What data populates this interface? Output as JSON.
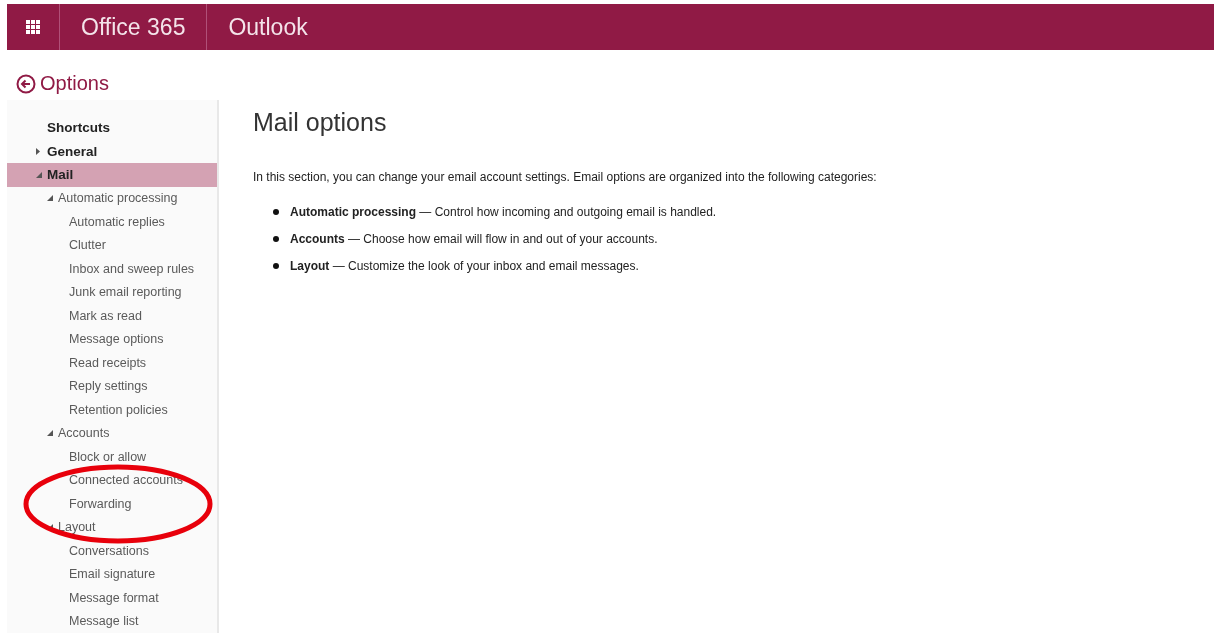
{
  "header": {
    "suite": "Office 365",
    "app": "Outlook"
  },
  "back": {
    "label": "Options"
  },
  "nav": [
    {
      "label": "Shortcuts",
      "selected": false
    },
    {
      "label": "General",
      "selected": false,
      "expanded": false
    },
    {
      "label": "Mail",
      "selected": true,
      "expanded": true,
      "children": [
        {
          "label": "Automatic processing",
          "selected": false,
          "expanded": true,
          "children": [
            {
              "label": "Automatic replies",
              "selected": false
            },
            {
              "label": "Clutter",
              "selected": false
            },
            {
              "label": "Inbox and sweep rules",
              "selected": false
            },
            {
              "label": "Junk email reporting",
              "selected": false
            },
            {
              "label": "Mark as read",
              "selected": false
            },
            {
              "label": "Message options",
              "selected": false
            },
            {
              "label": "Read receipts",
              "selected": false
            },
            {
              "label": "Reply settings",
              "selected": false
            },
            {
              "label": "Retention policies",
              "selected": false
            }
          ]
        },
        {
          "label": "Accounts",
          "selected": false,
          "expanded": true,
          "children": [
            {
              "label": "Block or allow",
              "selected": false
            },
            {
              "label": "Connected accounts",
              "selected": false
            },
            {
              "label": "Forwarding",
              "selected": false
            }
          ]
        },
        {
          "label": "Layout",
          "selected": false,
          "expanded": true,
          "children": [
            {
              "label": "Conversations",
              "selected": false
            },
            {
              "label": "Email signature",
              "selected": false
            },
            {
              "label": "Message format",
              "selected": false
            },
            {
              "label": "Message list",
              "selected": false
            }
          ]
        }
      ]
    }
  ],
  "content": {
    "title": "Mail options",
    "intro": "In this section, you can change your email account settings. Email options are organized into the following categories:",
    "categories": [
      {
        "text": "**Automatic processing** — Control how incoming and outgoing email is handled."
      },
      {
        "text": "**Accounts** — Choose how email will flow in and out of your accounts."
      },
      {
        "text": "**Layout** — Customize the look of your inbox and email messages."
      }
    ]
  }
}
